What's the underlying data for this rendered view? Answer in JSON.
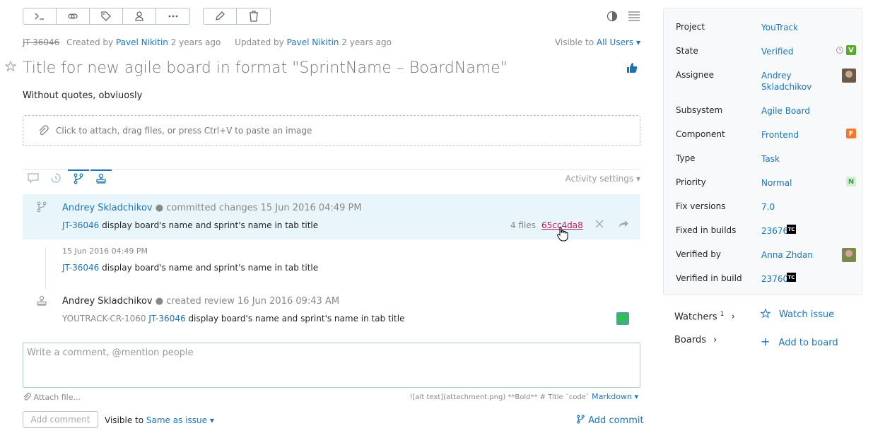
{
  "meta": {
    "issue_id": "JT-36046",
    "created_by_prefix": "Created by",
    "created_by": "Pavel Nikitin",
    "created_ago": "2 years ago",
    "updated_by_prefix": "Updated by",
    "updated_by": "Pavel Nikitin",
    "updated_ago": "2 years ago",
    "visible_to_prefix": "Visible to",
    "visible_to": "All Users"
  },
  "issue": {
    "title": "Title for new agile board in format \"SprintName – BoardName\"",
    "description": "Without quotes, obviuosly",
    "attach_hint": "Click to attach, drag files, or press Ctrl+V to paste an image"
  },
  "activity": {
    "settings_label": "Activity settings",
    "commit": {
      "author": "Andrey Skladchikov",
      "action": "committed changes",
      "date": "15 Jun 2016 04:49 PM",
      "issue_link": "JT-36046",
      "message": "display board's name and sprint's name in tab title",
      "files": "4 files",
      "hash": "65cc4da8"
    },
    "commit2": {
      "date": "15 Jun 2016 04:49 PM",
      "issue_link": "JT-36046",
      "message": "display board's name and sprint's name in tab title"
    },
    "review": {
      "author": "Andrey Skladchikov",
      "action": "created review",
      "date": "16 Jun 2016 09:43 AM",
      "review_id": "YOUTRACK-CR-1060",
      "issue_link": "JT-36046",
      "message": "display board's name and sprint's name in tab title"
    }
  },
  "comment": {
    "placeholder": "Write a comment, @mention people",
    "attach_file": "Attach file...",
    "markdown_hint": "![alt text](attachment.png) **Bold** # Title `code`",
    "markdown_label": "Markdown",
    "add_button": "Add comment",
    "visible_prefix": "Visible to",
    "visible_value": "Same as issue",
    "add_commit": "Add commit"
  },
  "fields": [
    {
      "label": "Project",
      "value": "YouTrack"
    },
    {
      "label": "State",
      "value": "Verified",
      "badge": "V"
    },
    {
      "label": "Assignee",
      "value": "Andrey Skladchikov"
    },
    {
      "label": "Subsystem",
      "value": "Agile Board"
    },
    {
      "label": "Component",
      "value": "Frontend",
      "badge": "F"
    },
    {
      "label": "Type",
      "value": "Task"
    },
    {
      "label": "Priority",
      "value": "Normal",
      "badge": "N"
    },
    {
      "label": "Fix versions",
      "value": "7.0"
    },
    {
      "label": "Fixed in builds",
      "value": "23676",
      "tc": "TC"
    },
    {
      "label": "Verified by",
      "value": "Anna Zhdan"
    },
    {
      "label": "Verified in build",
      "value": "23760",
      "tc": "TC"
    }
  ],
  "watchers": {
    "label": "Watchers",
    "count": "1",
    "action": "Watch issue"
  },
  "boards": {
    "label": "Boards",
    "action": "Add to board"
  },
  "colors": {
    "accent": "#1c74b8",
    "state_badge": "#59a829",
    "component_badge": "#f3772a",
    "priority_badge": "#c7ecc7"
  }
}
